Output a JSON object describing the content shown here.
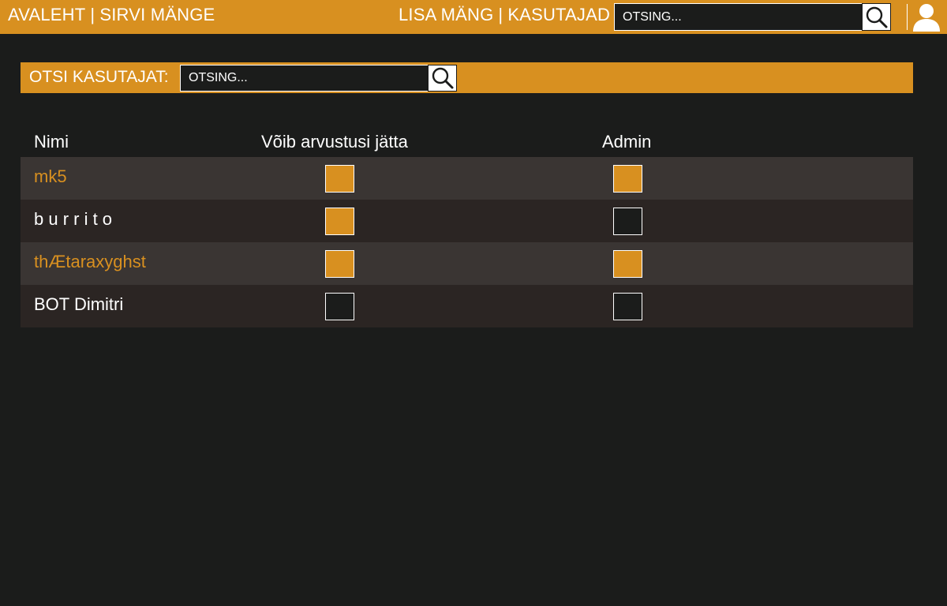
{
  "nav": {
    "home": "AVALEHT",
    "rate_games": "SIRVI MÄNGE",
    "add_game": "LISA MÄNG",
    "users": "KASUTAJAD",
    "separator": "|"
  },
  "top_search": {
    "placeholder": "OTSING..."
  },
  "user_search": {
    "label": "OTSI KASUTAJAT:",
    "placeholder": "OTSING..."
  },
  "table": {
    "columns": {
      "name": "Nimi",
      "can_review": "Võib arvustusi jätta",
      "admin": "Admin"
    },
    "rows": [
      {
        "name": "mk5",
        "can_review": true,
        "admin": true
      },
      {
        "name": "b u r r i t o",
        "can_review": true,
        "admin": false
      },
      {
        "name": "thÆtaraxyghst",
        "can_review": true,
        "admin": true
      },
      {
        "name": "BOT Dimitri",
        "can_review": false,
        "admin": false
      }
    ]
  },
  "colors": {
    "accent": "#d89020",
    "background": "#1b1c1b",
    "row_odd": "#3a3533",
    "row_even": "#2b2523",
    "text": "#ffffff"
  },
  "icons": {
    "search": "search-icon",
    "user": "user-icon"
  }
}
